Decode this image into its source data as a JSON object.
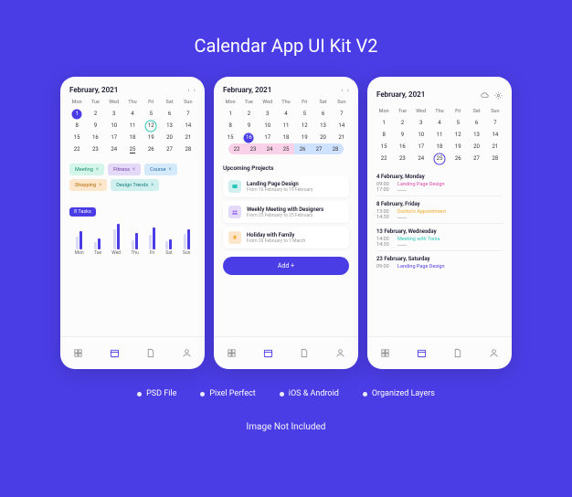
{
  "title": "Calendar App UI Kit V2",
  "features": [
    "PSD File",
    "Pixel Perfect",
    "iOS & Android",
    "Organized Layers"
  ],
  "footer_note": "Image Not Included",
  "dow": [
    "Mon",
    "Tue",
    "Wed",
    "Thu",
    "Fri",
    "Sat",
    "Sun"
  ],
  "month_label": "February, 2021",
  "screen1": {
    "tags": [
      {
        "label": "Meeting",
        "cls": "green"
      },
      {
        "label": "Fitness",
        "cls": "purple"
      },
      {
        "label": "Course",
        "cls": "blue"
      },
      {
        "label": "Shopping",
        "cls": "orange"
      },
      {
        "label": "Design Trends",
        "cls": "teal"
      }
    ],
    "tasks_badge": "8 Tasks",
    "chart_data": {
      "type": "bar",
      "categories": [
        "Mon",
        "Tue",
        "Wed",
        "Thu",
        "Fri",
        "Sat",
        "Sun"
      ],
      "series": [
        {
          "name": "light",
          "values": [
            14,
            8,
            22,
            10,
            16,
            9,
            17
          ]
        },
        {
          "name": "dark",
          "values": [
            20,
            12,
            28,
            18,
            24,
            11,
            22
          ]
        }
      ],
      "ylim": [
        0,
        30
      ]
    }
  },
  "screen2": {
    "section_title": "Upcoming Projects",
    "projects": [
      {
        "title": "Landing Page Design",
        "sub": "From 16 February to 19 February",
        "icon": "teal"
      },
      {
        "title": "Weekly Meeting with Designers",
        "sub": "From 25 February to 25 February",
        "icon": "purple"
      },
      {
        "title": "Holiday with Family",
        "sub": "From 26 February to 1 March",
        "icon": "orange"
      }
    ],
    "add_label": "Add   +"
  },
  "screen3": {
    "events": [
      {
        "date": "4 February, Monday",
        "lines": [
          {
            "time": "09:00",
            "name": "Landing Page Design",
            "cls": "pink"
          },
          {
            "time": "17:00",
            "name": "",
            "cls": ""
          }
        ]
      },
      {
        "date": "8 February, Friday",
        "lines": [
          {
            "time": "13:00",
            "name": "Doctor's Appointment",
            "cls": "orange"
          },
          {
            "time": "14:30",
            "name": "",
            "cls": ""
          }
        ]
      },
      {
        "date": "13 February, Wednesday",
        "lines": [
          {
            "time": "14:00",
            "name": "Meeting with Tonia",
            "cls": "teal"
          },
          {
            "time": "14:30",
            "name": "",
            "cls": ""
          }
        ]
      },
      {
        "date": "23 February, Saturday",
        "lines": [
          {
            "time": "09:00",
            "name": "Landing Page Design",
            "cls": "blue"
          }
        ]
      }
    ]
  },
  "weeks1": [
    [
      "1",
      "2",
      "3",
      "4",
      "5",
      "6",
      "7"
    ],
    [
      "8",
      "9",
      "10",
      "11",
      "12",
      "13",
      "14"
    ],
    [
      "15",
      "16",
      "17",
      "18",
      "19",
      "20",
      "21"
    ],
    [
      "22",
      "23",
      "24",
      "25",
      "26",
      "27",
      "28"
    ]
  ],
  "weeks2_row3": [
    "15",
    "16",
    "17",
    "18",
    "19",
    "20",
    "21"
  ],
  "range_row": [
    "22",
    "23",
    "24",
    "25",
    "26",
    "27",
    "28"
  ]
}
